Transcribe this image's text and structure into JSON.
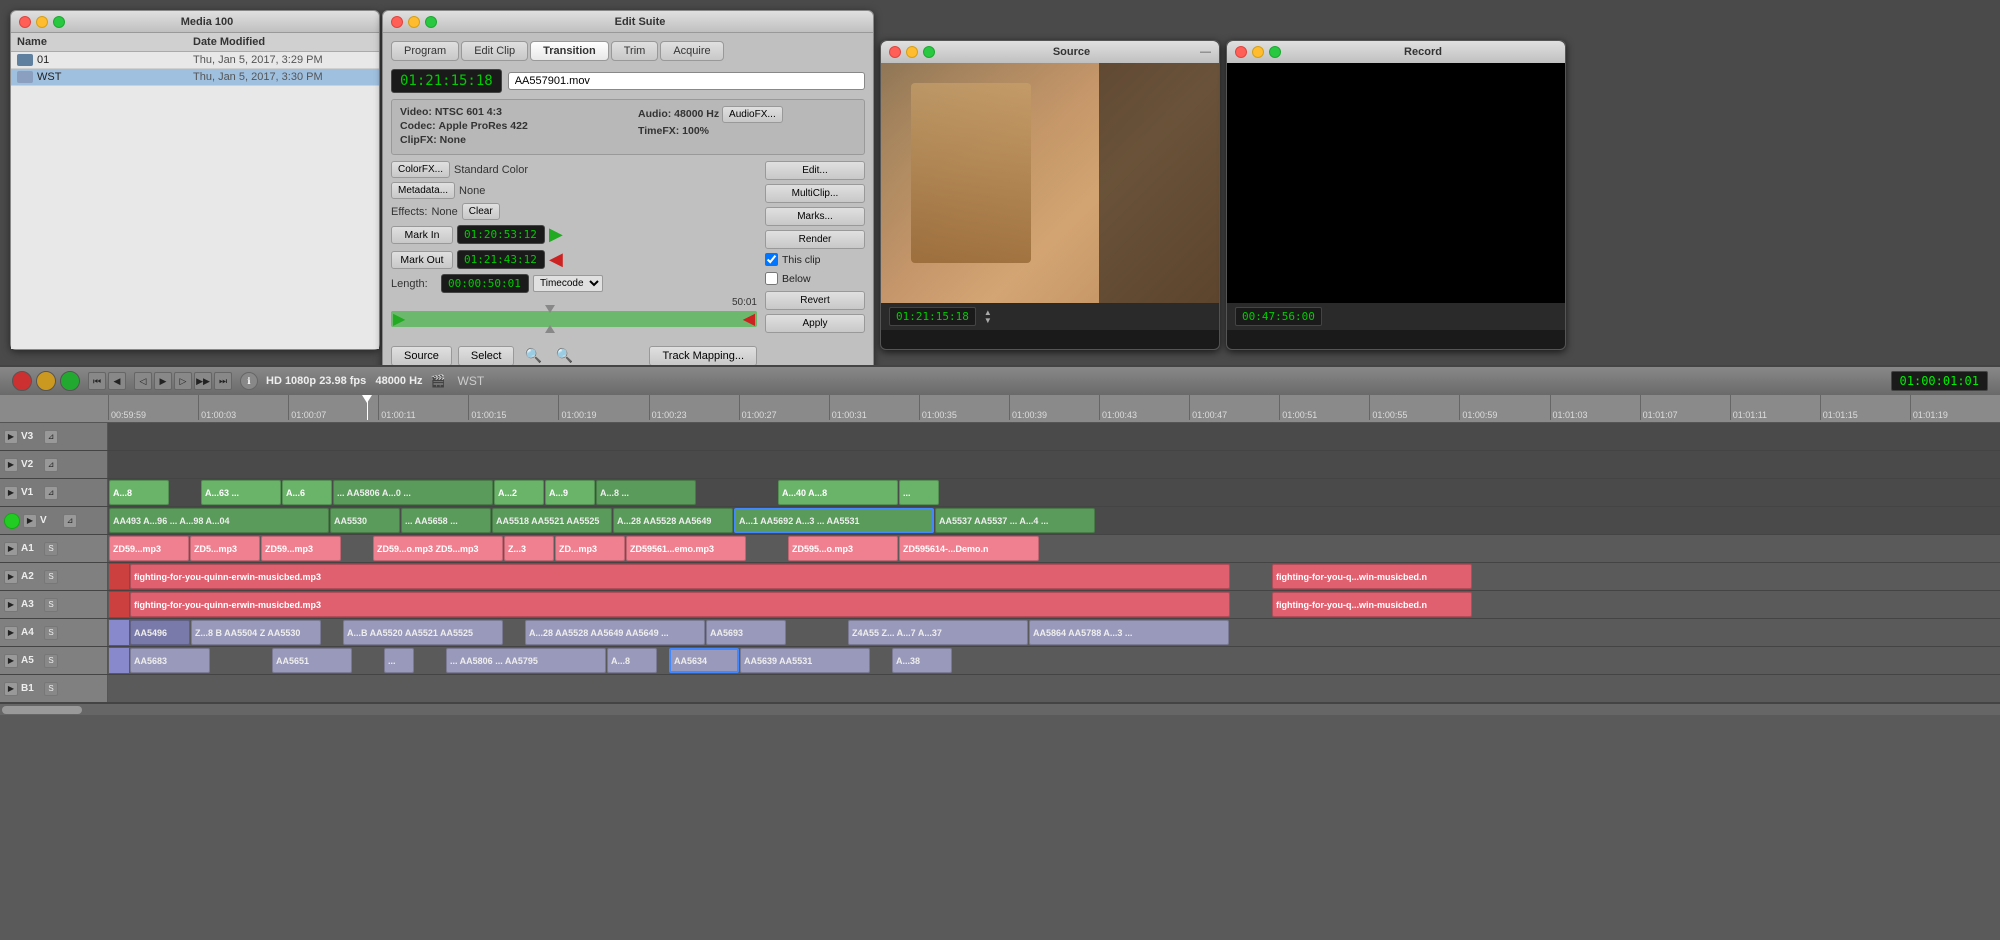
{
  "media100": {
    "title": "Media 100",
    "columns": {
      "name": "Name",
      "dateModified": "Date Modified"
    },
    "items": [
      {
        "name": "01",
        "date": "Thu, Jan 5, 2017, 3:29 PM",
        "type": "file"
      },
      {
        "name": "WST",
        "date": "Thu, Jan 5, 2017, 3:30 PM",
        "type": "folder",
        "selected": true
      }
    ]
  },
  "editSuite": {
    "title": "Edit Suite",
    "tabs": [
      "Program",
      "Edit Clip",
      "Transition",
      "Trim",
      "Acquire"
    ],
    "activeTab": "Transition",
    "timecode": "01:21:15:18",
    "filename": "AA557901.mov",
    "video": {
      "label": "Video:",
      "value": "NTSC 601 4:3"
    },
    "codec": {
      "label": "Codec:",
      "value": "Apple ProRes 422"
    },
    "clipfx": {
      "label": "ClipFX:",
      "value": "None"
    },
    "audio": {
      "label": "Audio:",
      "value": "48000 Hz"
    },
    "timefx": {
      "label": "TimeFX:",
      "value": "100%"
    },
    "audiofxBtn": "AudioFX...",
    "colorFxBtn": "ColorFX...",
    "colorValue": "Standard Color",
    "metadataBtn": "Metadata...",
    "metadataValue": "None",
    "effects": {
      "label": "Effects:",
      "value": "None"
    },
    "clearBtn": "Clear",
    "markInBtn": "Mark In",
    "markInTime": "01:20:53:12",
    "markOutBtn": "Mark Out",
    "markOutTime": "01:21:43:12",
    "lengthLabel": "Length:",
    "lengthTime": "00:00:50:01",
    "timecodeDropdown": "Timecode",
    "scrubEnd": "50:01",
    "sourceBtn": "Source",
    "selectBtn": "Select",
    "trackMappingBtn": "Track Mapping...",
    "editBtn": "Edit...",
    "multiClipBtn": "MultiClip...",
    "marksBtn": "Marks...",
    "renderBtn": "Render",
    "thisClipLabel": "This clip",
    "belowLabel": "Below",
    "revertBtn": "Revert",
    "applyBtn": "Apply"
  },
  "source": {
    "title": "Source",
    "timecode": "01:21:15:18"
  },
  "record": {
    "title": "Record",
    "timecode": "00:47:56:00"
  },
  "timeline": {
    "wstTitle": "WST",
    "format": "HD 1080p 23.98 fps",
    "sampleRate": "48000 Hz",
    "currentTime": "01:00:01:01",
    "rulerMarks": [
      "00:59:59",
      "01:00:03",
      "01:00:07",
      "01:00:11",
      "01:00:15",
      "01:00:19",
      "01:00:23",
      "01:00:27",
      "01:00:31",
      "01:00:35",
      "01:00:39",
      "01:00:43",
      "01:00:47",
      "01:00:51",
      "01:00:55",
      "01:00:59",
      "01:01:03",
      "01:01:07",
      "01:01:11",
      "01:01:15",
      "01:01:19"
    ],
    "tracks": [
      {
        "name": "V3",
        "type": "video",
        "clips": []
      },
      {
        "name": "V2",
        "type": "video",
        "clips": []
      },
      {
        "name": "V1",
        "type": "video",
        "clips": [
          {
            "label": "A...8",
            "color": "video-bright"
          },
          {
            "label": "A...63 ...",
            "color": "video-bright"
          },
          {
            "label": "A...6",
            "color": "video-bright"
          },
          {
            "label": "... AA5806 A...0 ...",
            "color": "video"
          },
          {
            "label": "A...2",
            "color": "video-bright"
          },
          {
            "label": "A...9",
            "color": "video-bright"
          },
          {
            "label": "A...8 ...",
            "color": "video"
          },
          {
            "label": "...",
            "color": "video-bright"
          },
          {
            "label": "A...40 A...8",
            "color": "video-bright"
          },
          {
            "label": "...",
            "color": "video-bright"
          }
        ]
      },
      {
        "name": "V",
        "type": "video",
        "hasGreenIndicator": true,
        "clips": [
          {
            "label": "AA493 A...96 ... ... A...98 A...04",
            "color": "video"
          },
          {
            "label": "AA5530",
            "color": "video"
          },
          {
            "label": "... AA5658 ...",
            "color": "video"
          },
          {
            "label": "AA5518 AA5521 AA5525",
            "color": "video"
          },
          {
            "label": "A...28 AA5528 AA5649",
            "color": "video"
          },
          {
            "label": "A...1 AA5692 A...39 A...3 ... AA5531",
            "color": "video-selected"
          },
          {
            "label": "AA5537 AA5537 ... A...4 ...",
            "color": "video"
          }
        ]
      },
      {
        "name": "A1",
        "type": "audio",
        "clips": [
          {
            "label": "ZD59...mp3",
            "color": "audio-light"
          },
          {
            "label": "ZD5...mp3",
            "color": "audio-light"
          },
          {
            "label": "ZD59...mp3",
            "color": "audio-light"
          },
          {
            "label": "ZD59...o.mp3 ZD5...mp3",
            "color": "audio-light"
          },
          {
            "label": "Z...3",
            "color": "audio-light"
          },
          {
            "label": "ZD...mp3",
            "color": "audio-light"
          },
          {
            "label": "ZD59561...emo.mp3",
            "color": "audio-light"
          },
          {
            "label": "ZD595...o.mp3",
            "color": "audio-light"
          },
          {
            "label": "ZD595614-...Demo.n",
            "color": "audio-light"
          }
        ]
      },
      {
        "name": "A2",
        "type": "audio",
        "clips": [
          {
            "label": "fighting-for-you-quinn-erwin-musicbed.mp3",
            "color": "audio-pink",
            "wide": true
          },
          {
            "label": "fighting-for-you-q...win-musicbed.n",
            "color": "audio-pink"
          }
        ]
      },
      {
        "name": "A3",
        "type": "audio",
        "clips": [
          {
            "label": "fighting-for-you-quinn-erwin-musicbed.mp3",
            "color": "audio-pink",
            "wide": true
          },
          {
            "label": "fighting-for-you-q...win-musicbed.n",
            "color": "audio-pink"
          }
        ]
      },
      {
        "name": "A4",
        "type": "audio",
        "clips": [
          {
            "label": "AA5496",
            "color": "video"
          },
          {
            "label": "Z...8 B AA5504 Z AA5530",
            "color": "video"
          },
          {
            "label": "A...B AA5520 AA5521 AA5525",
            "color": "video"
          },
          {
            "label": "A...28 AA5528 AA5649 AA5649 ...",
            "color": "video"
          },
          {
            "label": "AA5693",
            "color": "video"
          },
          {
            "label": "...Z4A55 Z... A...7 A...37",
            "color": "video"
          },
          {
            "label": "AA5864 AA5788 A...3 ...",
            "color": "video"
          }
        ]
      },
      {
        "name": "A5",
        "type": "audio",
        "clips": [
          {
            "label": "AA5683",
            "color": "video"
          },
          {
            "label": "AA5651",
            "color": "video"
          },
          {
            "label": "...",
            "color": "video"
          },
          {
            "label": "... AA5806 ... AA5795",
            "color": "video"
          },
          {
            "label": "A...8",
            "color": "video"
          },
          {
            "label": "AA5634",
            "color": "video-selected"
          },
          {
            "label": "AA5639 AA5531",
            "color": "video"
          },
          {
            "label": "A...38",
            "color": "video"
          }
        ]
      },
      {
        "name": "B1",
        "type": "audio",
        "clips": []
      }
    ]
  }
}
